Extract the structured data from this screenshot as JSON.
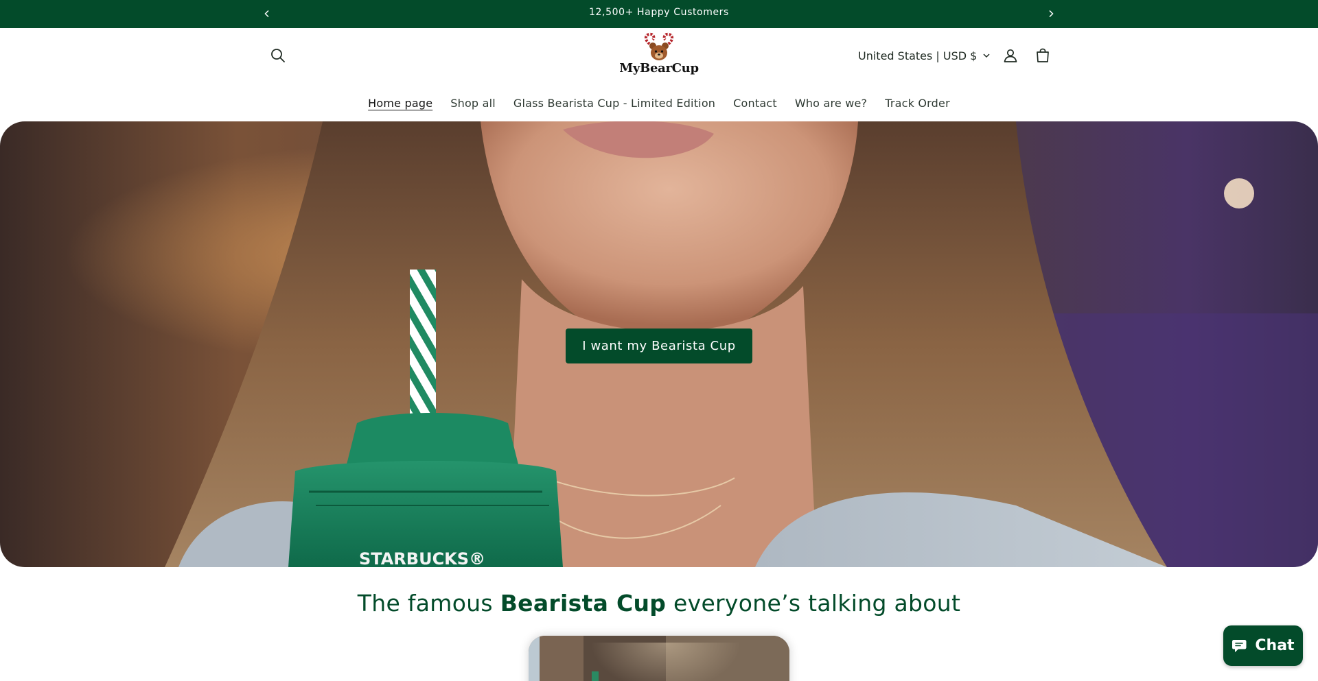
{
  "announcement": {
    "message": "12,500+ Happy Customers",
    "prev_icon": "chevron-left-icon",
    "next_icon": "chevron-right-icon"
  },
  "header": {
    "logo_text": "MyBearCup",
    "search_icon": "search-icon",
    "country_selector": "United States | USD $",
    "account_icon": "user-icon",
    "cart_icon": "cart-icon"
  },
  "nav": {
    "items": [
      {
        "label": "Home page",
        "active": true
      },
      {
        "label": "Shop all",
        "active": false
      },
      {
        "label": "Glass Bearista Cup - Limited Edition",
        "active": false
      },
      {
        "label": "Contact",
        "active": false
      },
      {
        "label": "Who are we?",
        "active": false
      },
      {
        "label": "Track Order",
        "active": false
      }
    ]
  },
  "hero": {
    "button_label": "I want my Bearista Cup",
    "cup_brand_text": "STARBUCKS®"
  },
  "section": {
    "heading_prefix": "The famous ",
    "heading_bold": "Bearista Cup",
    "heading_suffix": " everyone’s talking about"
  },
  "chat": {
    "label": "Chat",
    "icon": "chat-bubble-icon"
  },
  "colors": {
    "brand_green": "#034b2a",
    "background": "#ffffff"
  }
}
